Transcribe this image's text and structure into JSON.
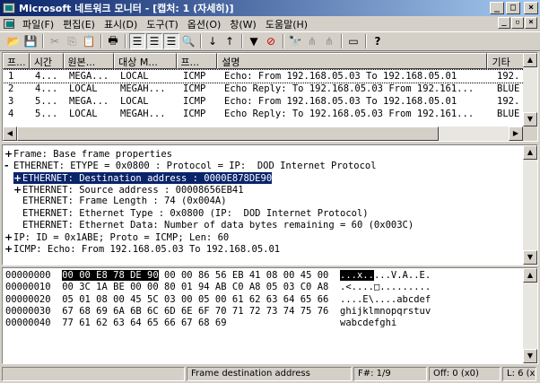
{
  "window": {
    "title": "Microsoft 네트워크 모니터 - [캡처: 1 (자세히)]",
    "min": "_",
    "max": "□",
    "close": "×"
  },
  "menu": [
    "파일(F)",
    "편집(E)",
    "표시(D)",
    "도구(T)",
    "옵션(O)",
    "창(W)",
    "도움말(H)"
  ],
  "mdi": {
    "min": "_",
    "restore": "▫",
    "close": "×"
  },
  "toolbar_icons": [
    {
      "name": "open-icon",
      "glyph": "📂"
    },
    {
      "name": "save-icon",
      "glyph": "💾"
    },
    {
      "name": "cut-icon",
      "glyph": "✂"
    },
    {
      "name": "copy-icon",
      "glyph": "⎘"
    },
    {
      "name": "paste-icon",
      "glyph": "📋"
    },
    {
      "name": "print-icon",
      "glyph": "🖶"
    },
    {
      "name": "summary-pane-icon",
      "glyph": "☰"
    },
    {
      "name": "detail-pane-icon",
      "glyph": "☰"
    },
    {
      "name": "hex-pane-icon",
      "glyph": "☰"
    },
    {
      "name": "zoom-icon",
      "glyph": "🔍"
    },
    {
      "name": "next-frame-icon",
      "glyph": "↓"
    },
    {
      "name": "prev-frame-icon",
      "glyph": "↑"
    },
    {
      "name": "filter-icon",
      "glyph": "▼"
    },
    {
      "name": "apply-filter-icon",
      "glyph": "⊘"
    },
    {
      "name": "find-icon",
      "glyph": "🔭"
    },
    {
      "name": "find-next-icon",
      "glyph": "⋔"
    },
    {
      "name": "find-prev-icon",
      "glyph": "⋔"
    },
    {
      "name": "window-icon",
      "glyph": "▭"
    },
    {
      "name": "help-icon",
      "glyph": "?"
    }
  ],
  "summary": {
    "columns": [
      "프...",
      "시간",
      "원본...",
      "대상 M...",
      "프...",
      "설명",
      "기타"
    ],
    "rows": [
      [
        "1",
        "4...",
        "MEGA...",
        "LOCAL",
        "ICMP",
        "Echo: From 192.168.05.03 To 192.168.05.01",
        "192."
      ],
      [
        "2",
        "4...",
        "LOCAL",
        "MEGAH...",
        "ICMP",
        "Echo Reply: To 192.168.05.03 From 192.161...",
        "BLUE"
      ],
      [
        "3",
        "5...",
        "MEGA...",
        "LOCAL",
        "ICMP",
        "Echo: From 192.168.05.03 To 192.168.05.01",
        "192."
      ],
      [
        "4",
        "5...",
        "LOCAL",
        "MEGAH...",
        "ICMP",
        "Echo Reply: To 192.168.05.03 From 192.161...",
        "BLUE"
      ]
    ]
  },
  "detail": {
    "lines": [
      {
        "exp": "+",
        "text": "Frame: Base frame properties"
      },
      {
        "exp": "-",
        "text": "ETHERNET: ETYPE = 0x0800 : Protocol = IP:  DOD Internet Protocol"
      },
      {
        "exp": "+",
        "text": "ETHERNET: Destination address : 0000E878DE90"
      },
      {
        "exp": "+",
        "text": "ETHERNET: Source address : 00008656EB41"
      },
      {
        "exp": "",
        "text": "ETHERNET: Frame Length : 74 (0x004A)"
      },
      {
        "exp": "",
        "text": "ETHERNET: Ethernet Type : 0x0800 (IP:  DOD Internet Protocol)"
      },
      {
        "exp": "",
        "text": "ETHERNET: Ethernet Data: Number of data bytes remaining = 60 (0x003C)"
      },
      {
        "exp": "+",
        "text": "IP: ID = 0x1ABE; Proto = ICMP; Len: 60"
      },
      {
        "exp": "+",
        "text": "ICMP: Echo: From 192.168.05.03 To 192.168.05.01"
      }
    ]
  },
  "hex": {
    "lines": [
      {
        "offset": "00000000",
        "hi": "00 00 E8 78 DE 90",
        "bytes": " 00 00 86 56 EB 41 08 00 45 00",
        "ahi": "...x..",
        "ascii": "...V.A..E."
      },
      {
        "offset": "00000010",
        "hi": "",
        "bytes": "00 3C 1A BE 00 00 80 01 94 AB C0 A8 05 03 C0 A8",
        "ahi": "",
        "ascii": ".<....□........."
      },
      {
        "offset": "00000020",
        "hi": "",
        "bytes": "05 01 08 00 45 5C 03 00 05 00 61 62 63 64 65 66",
        "ahi": "",
        "ascii": "....E\\....abcdef"
      },
      {
        "offset": "00000030",
        "hi": "",
        "bytes": "67 68 69 6A 6B 6C 6D 6E 6F 70 71 72 73 74 75 76",
        "ahi": "",
        "ascii": "ghijklmnopqrstuv"
      },
      {
        "offset": "00000040",
        "hi": "",
        "bytes": "77 61 62 63 64 65 66 67 68 69",
        "ahi": "",
        "ascii": "wabcdefghi"
      }
    ]
  },
  "status": {
    "main": "",
    "desc": "Frame destination address",
    "frame": "F#: 1/9",
    "offset": "Off: 0 (x0)",
    "length": "L: 6 (x"
  }
}
